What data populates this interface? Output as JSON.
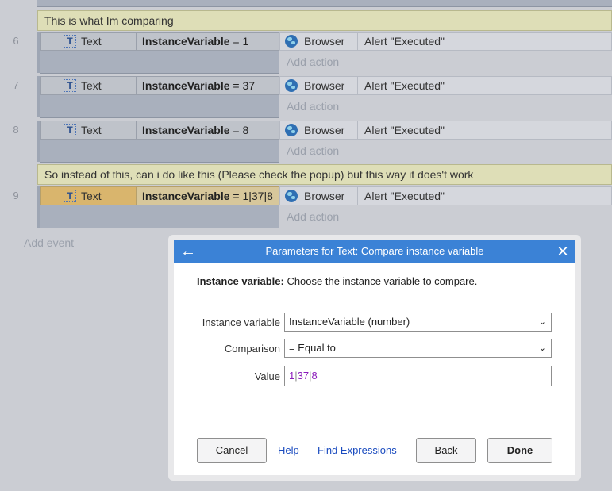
{
  "sheet": {
    "comment1": "This is what Im comparing",
    "comment2": "So instead of this, can i do like this (Please check the popup) but this way it does't work",
    "add_action_label": "Add action",
    "add_event_label": "Add event",
    "events": [
      {
        "row": "6",
        "object": "Text",
        "cond_var": "InstanceVariable",
        "cond_rest": " = 1",
        "action_object": "Browser",
        "action": "Alert \"Executed\""
      },
      {
        "row": "7",
        "object": "Text",
        "cond_var": "InstanceVariable",
        "cond_rest": " = 37",
        "action_object": "Browser",
        "action": "Alert \"Executed\""
      },
      {
        "row": "8",
        "object": "Text",
        "cond_var": "InstanceVariable",
        "cond_rest": " = 8",
        "action_object": "Browser",
        "action": "Alert \"Executed\""
      },
      {
        "row": "9",
        "object": "Text",
        "cond_var": "InstanceVariable",
        "cond_rest": " = 1|37|8",
        "action_object": "Browser",
        "action": "Alert \"Executed\""
      }
    ]
  },
  "dialog": {
    "title": "Parameters for Text: Compare instance variable",
    "desc_label": "Instance variable:",
    "desc_text": " Choose the instance variable to compare.",
    "fields": {
      "instance_variable": {
        "label": "Instance variable",
        "value": "InstanceVariable (number)"
      },
      "comparison": {
        "label": "Comparison",
        "value": "= Equal to"
      },
      "value": {
        "label": "Value",
        "parts": [
          "1",
          "|",
          "37",
          "|",
          "8"
        ]
      }
    },
    "buttons": {
      "cancel": "Cancel",
      "help": "Help",
      "find": "Find Expressions",
      "back": "Back",
      "done": "Done"
    }
  },
  "icons": {
    "back": "arrow-left-icon",
    "close": "close-icon",
    "dropdown": "chevron-down-icon",
    "text_object": "text-object-icon",
    "browser": "globe-icon"
  },
  "colors": {
    "header": "#3b82d6",
    "comment": "#dedeb7",
    "selected": "#d9b56d",
    "link": "#1a4bbf",
    "value_text": "#8b1cbb"
  }
}
